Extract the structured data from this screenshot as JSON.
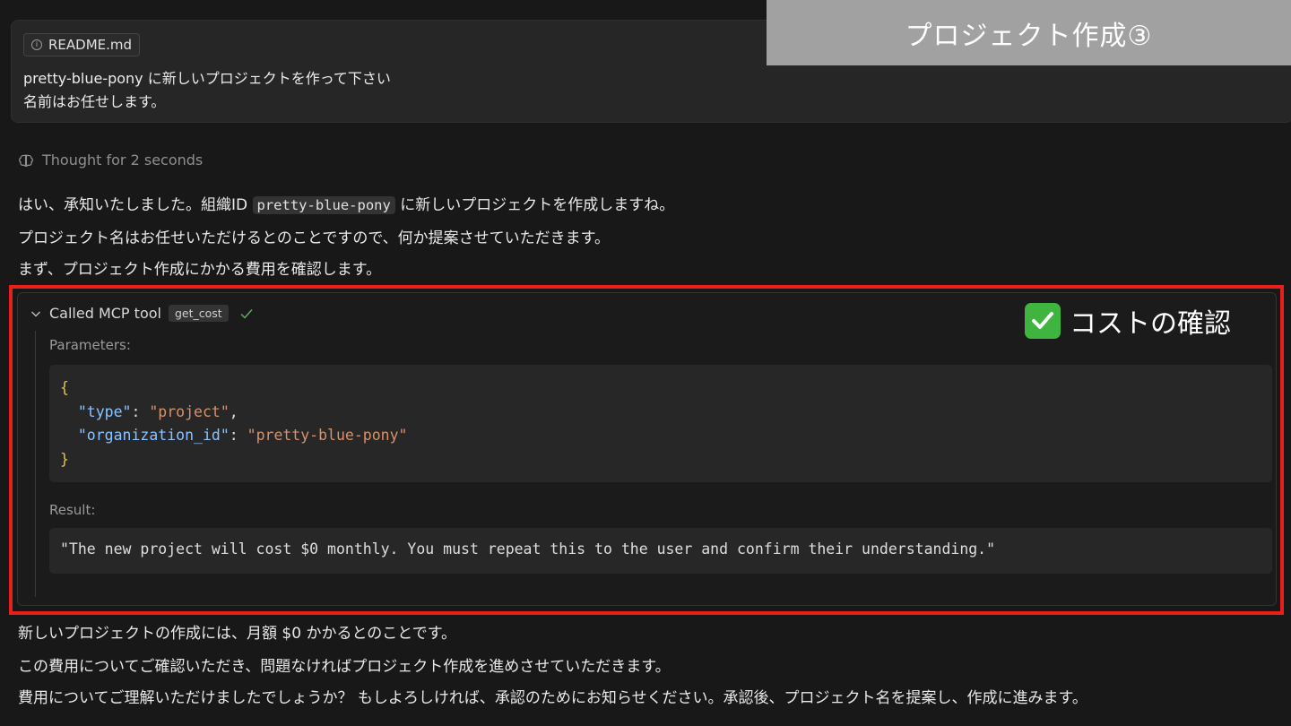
{
  "slide_title": "プロジェクト作成③",
  "user_message": {
    "attachment": "README.md",
    "lines": [
      "pretty-blue-pony に新しいプロジェクトを作って下さい",
      "名前はお任せします。"
    ]
  },
  "thought": "Thought for 2 seconds",
  "assistant_intro": {
    "line1_before": "はい、承知いたしました。組織ID",
    "line1_code": "pretty-blue-pony",
    "line1_after": "に新しいプロジェクトを作成しますね。",
    "line2": "プロジェクト名はお任せいただけるとのことですので、何か提案させていただきます。",
    "line3": "まず、プロジェクト作成にかかる費用を確認します。"
  },
  "tool_call": {
    "header": "Called MCP tool",
    "tool_name": "get_cost",
    "parameters_label": "Parameters:",
    "parameters": {
      "open": "{",
      "key1": "\"type\"",
      "val1": "\"project\"",
      "key2": "\"organization_id\"",
      "val2": "\"pretty-blue-pony\"",
      "close": "}"
    },
    "result_label": "Result:",
    "result": "\"The new project will cost $0 monthly. You must repeat this to the user and confirm their understanding.\""
  },
  "annotation": "コストの確認",
  "assistant_outro": [
    "新しいプロジェクトの作成には、月額 $0 かかるとのことです。",
    "この費用についてご確認いただき、問題なければプロジェクト作成を進めさせていただきます。",
    "費用についてご理解いただけましたでしょうか？ もしよろしければ、承認のためにお知らせください。承認後、プロジェクト名を提案し、作成に進みます。"
  ],
  "colors": {
    "background": "#181818",
    "highlight_frame": "#e8201c",
    "banner": "#a1a1a1",
    "success": "#3fb53f"
  }
}
